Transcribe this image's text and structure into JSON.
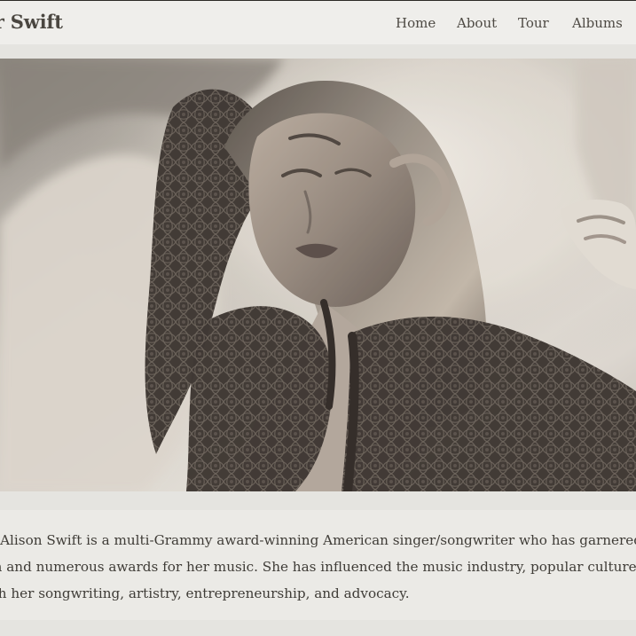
{
  "header": {
    "brand": "or Swift",
    "nav": [
      "Home",
      "About",
      "Tour",
      "Albums"
    ]
  },
  "hero": {
    "image": "sepia-portrait-photo"
  },
  "bio": {
    "lines": [
      "r Alison Swift is a multi-Grammy award-winning American singer/songwriter who has garnered v",
      "m and numerous awards for her music. She has influenced the music industry, popular culture, a",
      "gh her songwriting, artistry, entrepreneurship, and advocacy."
    ]
  },
  "colors": {
    "background": "#e5e4e0",
    "header": "#efeeeb",
    "bio_box": "#ebeae6",
    "text": "#3f3c37"
  }
}
